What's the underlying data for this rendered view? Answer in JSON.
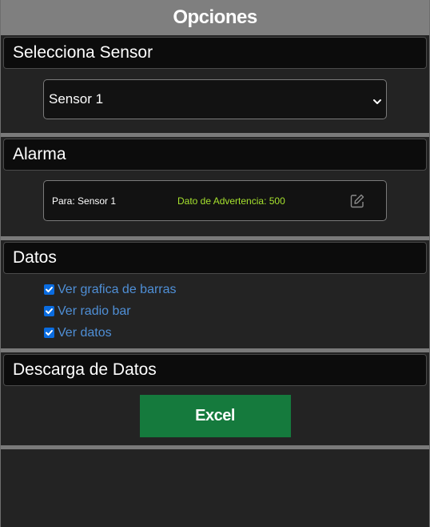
{
  "header": {
    "title": "Opciones"
  },
  "sensor_section": {
    "title": "Selecciona Sensor",
    "selected_value": "Sensor 1"
  },
  "alarm_section": {
    "title": "Alarma",
    "target_text": "Para: Sensor 1",
    "warning_text": "Dato de Advertencia: 500"
  },
  "data_section": {
    "title": "Datos",
    "options": [
      {
        "label": "Ver grafica de barras",
        "checked": true
      },
      {
        "label": "Ver radio bar",
        "checked": true
      },
      {
        "label": "Ver datos",
        "checked": true
      }
    ]
  },
  "download_section": {
    "title": "Descarga de Datos",
    "excel_label": "Excel"
  },
  "colors": {
    "background": "#232323",
    "header_bar": "#7f7f7f",
    "section_header": "#0c0c0c",
    "warning_text": "#a6e22e",
    "checkbox": "#0a6ce0",
    "link_text": "#4f8fd6",
    "excel_button": "#157a3d"
  },
  "icons": {
    "select": "chevron-down-icon",
    "edit": "edit-icon",
    "checkbox": "checkmark-icon"
  }
}
